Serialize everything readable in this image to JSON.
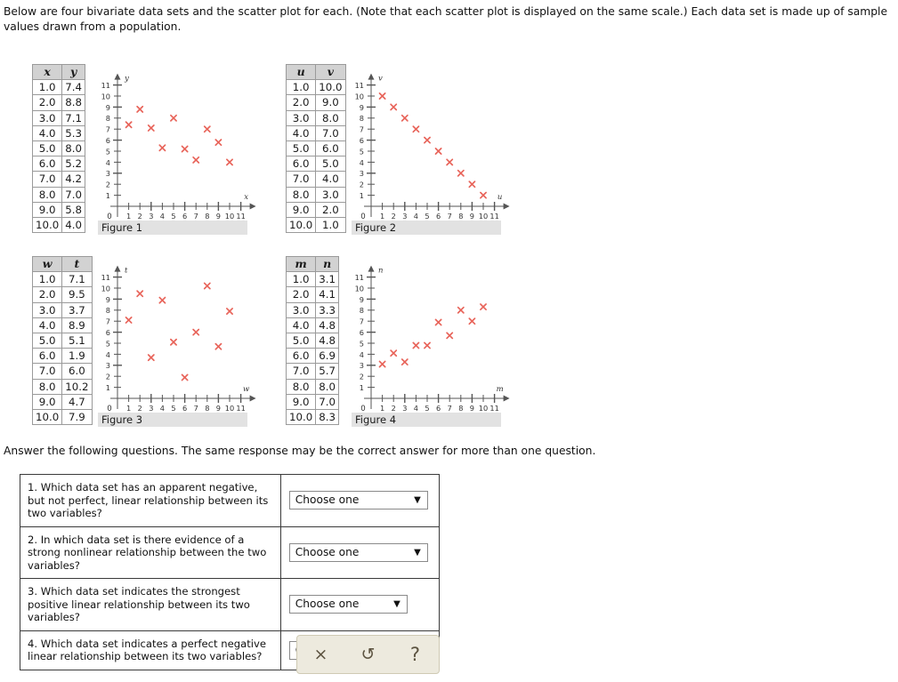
{
  "intro": "Below are four bivariate data sets and the scatter plot for each. (Note that each scatter plot is displayed on the same scale.) Each data set is made up of sample values drawn from a population.",
  "answer_instructions": "Answer the following questions. The same response may be the correct answer for more than one question.",
  "datasets": [
    {
      "id": "dataset-1",
      "caption": "Figure 1",
      "headers": [
        "x",
        "y"
      ],
      "x_label": "x",
      "y_label": "y",
      "rows": [
        [
          "1.0",
          "7.4"
        ],
        [
          "2.0",
          "8.8"
        ],
        [
          "3.0",
          "7.1"
        ],
        [
          "4.0",
          "5.3"
        ],
        [
          "5.0",
          "8.0"
        ],
        [
          "6.0",
          "5.2"
        ],
        [
          "7.0",
          "4.2"
        ],
        [
          "8.0",
          "7.0"
        ],
        [
          "9.0",
          "5.8"
        ],
        [
          "10.0",
          "4.0"
        ]
      ]
    },
    {
      "id": "dataset-2",
      "caption": "Figure 2",
      "headers": [
        "u",
        "v"
      ],
      "x_label": "u",
      "y_label": "v",
      "rows": [
        [
          "1.0",
          "10.0"
        ],
        [
          "2.0",
          "9.0"
        ],
        [
          "3.0",
          "8.0"
        ],
        [
          "4.0",
          "7.0"
        ],
        [
          "5.0",
          "6.0"
        ],
        [
          "6.0",
          "5.0"
        ],
        [
          "7.0",
          "4.0"
        ],
        [
          "8.0",
          "3.0"
        ],
        [
          "9.0",
          "2.0"
        ],
        [
          "10.0",
          "1.0"
        ]
      ]
    },
    {
      "id": "dataset-3",
      "caption": "Figure 3",
      "headers": [
        "w",
        "t"
      ],
      "x_label": "w",
      "y_label": "t",
      "rows": [
        [
          "1.0",
          "7.1"
        ],
        [
          "2.0",
          "9.5"
        ],
        [
          "3.0",
          "3.7"
        ],
        [
          "4.0",
          "8.9"
        ],
        [
          "5.0",
          "5.1"
        ],
        [
          "6.0",
          "1.9"
        ],
        [
          "7.0",
          "6.0"
        ],
        [
          "8.0",
          "10.2"
        ],
        [
          "9.0",
          "4.7"
        ],
        [
          "10.0",
          "7.9"
        ]
      ]
    },
    {
      "id": "dataset-4",
      "caption": "Figure 4",
      "headers": [
        "m",
        "n"
      ],
      "x_label": "m",
      "y_label": "n",
      "rows": [
        [
          "1.0",
          "3.1"
        ],
        [
          "2.0",
          "4.1"
        ],
        [
          "3.0",
          "3.3"
        ],
        [
          "4.0",
          "4.8"
        ],
        [
          "5.0",
          "4.8"
        ],
        [
          "6.0",
          "6.9"
        ],
        [
          "7.0",
          "5.7"
        ],
        [
          "8.0",
          "8.0"
        ],
        [
          "9.0",
          "7.0"
        ],
        [
          "10.0",
          "8.3"
        ]
      ]
    }
  ],
  "chart_data": [
    {
      "type": "scatter",
      "title": "Figure 1",
      "xlabel": "x",
      "ylabel": "y",
      "xlim": [
        0,
        11
      ],
      "ylim": [
        0,
        11
      ],
      "xticks": [
        1,
        2,
        3,
        4,
        5,
        6,
        7,
        8,
        9,
        10,
        11
      ],
      "yticks": [
        1,
        2,
        3,
        4,
        5,
        6,
        7,
        8,
        9,
        10,
        11
      ],
      "grid": false,
      "marker": "x",
      "marker_color": "#e8645a",
      "x": [
        1.0,
        2.0,
        3.0,
        4.0,
        5.0,
        6.0,
        7.0,
        8.0,
        9.0,
        10.0
      ],
      "y": [
        7.4,
        8.8,
        7.1,
        5.3,
        8.0,
        5.2,
        4.2,
        7.0,
        5.8,
        4.0
      ]
    },
    {
      "type": "scatter",
      "title": "Figure 2",
      "xlabel": "u",
      "ylabel": "v",
      "xlim": [
        0,
        11
      ],
      "ylim": [
        0,
        11
      ],
      "xticks": [
        1,
        2,
        3,
        4,
        5,
        6,
        7,
        8,
        9,
        10,
        11
      ],
      "yticks": [
        1,
        2,
        3,
        4,
        5,
        6,
        7,
        8,
        9,
        10,
        11
      ],
      "grid": false,
      "marker": "x",
      "marker_color": "#e8645a",
      "x": [
        1.0,
        2.0,
        3.0,
        4.0,
        5.0,
        6.0,
        7.0,
        8.0,
        9.0,
        10.0
      ],
      "y": [
        10.0,
        9.0,
        8.0,
        7.0,
        6.0,
        5.0,
        4.0,
        3.0,
        2.0,
        1.0
      ]
    },
    {
      "type": "scatter",
      "title": "Figure 3",
      "xlabel": "w",
      "ylabel": "t",
      "xlim": [
        0,
        11
      ],
      "ylim": [
        0,
        11
      ],
      "xticks": [
        1,
        2,
        3,
        4,
        5,
        6,
        7,
        8,
        9,
        10,
        11
      ],
      "yticks": [
        1,
        2,
        3,
        4,
        5,
        6,
        7,
        8,
        9,
        10,
        11
      ],
      "grid": false,
      "marker": "x",
      "marker_color": "#e8645a",
      "x": [
        1.0,
        2.0,
        3.0,
        4.0,
        5.0,
        6.0,
        7.0,
        8.0,
        9.0,
        10.0
      ],
      "y": [
        7.1,
        9.5,
        3.7,
        8.9,
        5.1,
        1.9,
        6.0,
        10.2,
        4.7,
        7.9
      ]
    },
    {
      "type": "scatter",
      "title": "Figure 4",
      "xlabel": "m",
      "ylabel": "n",
      "xlim": [
        0,
        11
      ],
      "ylim": [
        0,
        11
      ],
      "xticks": [
        1,
        2,
        3,
        4,
        5,
        6,
        7,
        8,
        9,
        10,
        11
      ],
      "yticks": [
        1,
        2,
        3,
        4,
        5,
        6,
        7,
        8,
        9,
        10,
        11
      ],
      "grid": false,
      "marker": "x",
      "marker_color": "#e8645a",
      "x": [
        1.0,
        2.0,
        3.0,
        4.0,
        5.0,
        6.0,
        7.0,
        8.0,
        9.0,
        10.0
      ],
      "y": [
        3.1,
        4.1,
        3.3,
        4.8,
        4.8,
        6.9,
        5.7,
        8.0,
        7.0,
        8.3
      ]
    }
  ],
  "questions": [
    {
      "text": "1. Which data set has an apparent negative, but not perfect, linear relationship between its two variables?",
      "select_value": "Choose one",
      "width": "full"
    },
    {
      "text": "2. In which data set is there evidence of a strong nonlinear relationship between the two variables?",
      "select_value": "Choose one",
      "width": "full"
    },
    {
      "text": "3. Which data set indicates the strongest positive linear relationship between its two variables?",
      "select_value": "Choose one",
      "width": "narrow"
    },
    {
      "text": "4. Which data set indicates a perfect negative linear relationship between its two variables?",
      "select_value": "Choose one",
      "width": "full"
    }
  ],
  "toolbar": {
    "close_label": "×",
    "reset_label": "↺",
    "help_label": "?"
  },
  "axis_zero_label": "0"
}
